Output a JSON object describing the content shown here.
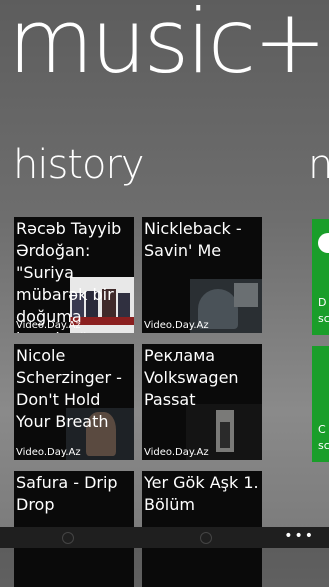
{
  "app": {
    "title": "music+"
  },
  "sections": {
    "current": "history",
    "next": "n"
  },
  "history": [
    {
      "title": "Rəcəb Tayyib Ərdoğan: \"Suriya mübarək bir doğuma hazırlır..\"",
      "source": "Video.Day.Az"
    },
    {
      "title": "Nickleback - Savin' Me",
      "source": "Video.Day.Az"
    },
    {
      "title": "Nicole Scherzinger - Don't Hold Your Breath",
      "source": "Video.Day.Az"
    },
    {
      "title": "Реклама Volkswagen Passat",
      "source": "Video.Day.Az"
    },
    {
      "title": "Safura - Drip Drop",
      "source": ""
    },
    {
      "title": "Yer Gök Aşk 1. Bölüm",
      "source": ""
    }
  ],
  "side_tiles": [
    {
      "line1": "D",
      "line2": "sc"
    },
    {
      "line1": "C",
      "line2": "sc"
    }
  ],
  "appbar": {
    "more": "•••"
  },
  "colors": {
    "accent": "#1a9e2a",
    "tile_bg": "#0a0a0a",
    "appbar_bg": "#1f1f1f"
  }
}
